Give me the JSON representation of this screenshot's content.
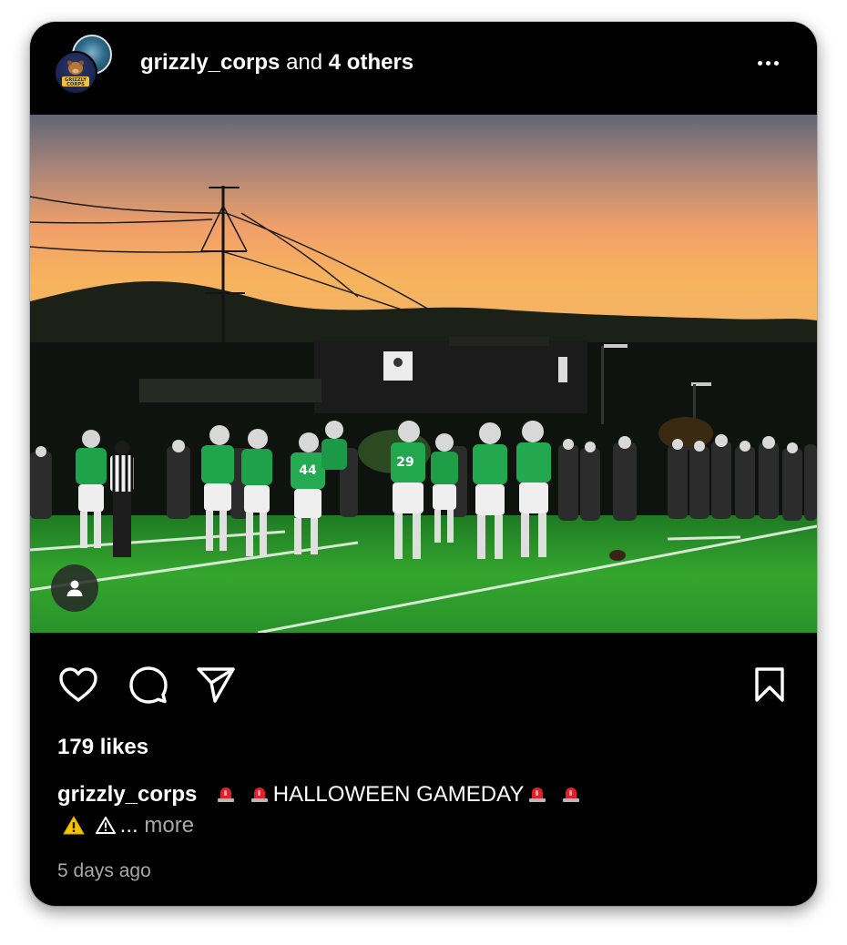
{
  "header": {
    "username": "grizzly_corps",
    "connector": "and",
    "others": "4 others",
    "avatar_text": "GRIZZLY CORPS",
    "more_icon": "more-horizontal-icon"
  },
  "post": {
    "photo_description_icon": "photo",
    "tag_icon": "person-icon"
  },
  "actions": {
    "like_icon": "heart-icon",
    "comment_icon": "comment-icon",
    "share_icon": "send-icon",
    "save_icon": "bookmark-icon"
  },
  "likes_text": "179 likes",
  "caption": {
    "username": "grizzly_corps",
    "text": "HALLOWEEN GAMEDAY",
    "ellipsis": "...",
    "more": "more"
  },
  "timestamp": "5 days ago",
  "colors": {
    "background": "#000000",
    "text": "#ffffff",
    "secondary_text": "#a8a8a8",
    "siren": "#e0202a",
    "warning": "#f5c400"
  }
}
